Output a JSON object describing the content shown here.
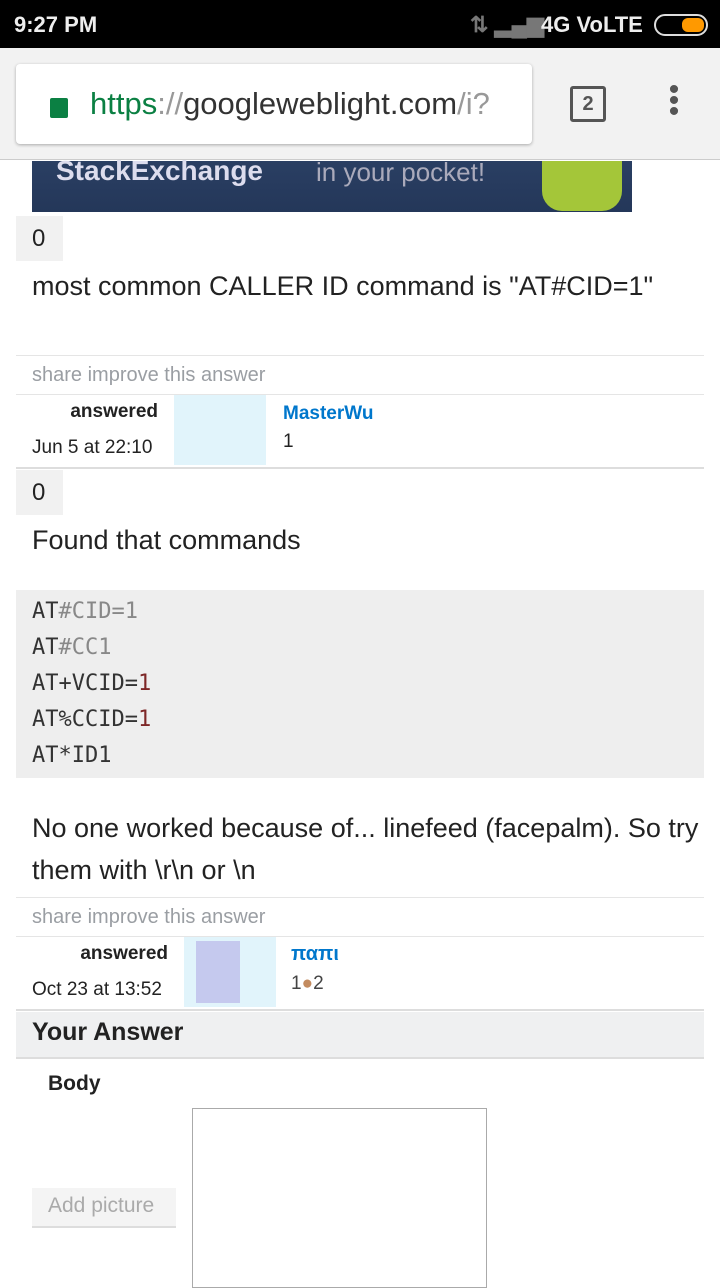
{
  "status": {
    "time": "9:27 PM",
    "network": "4G VoLTE"
  },
  "browser": {
    "url_scheme": "https",
    "url_sep": "://",
    "url_host": "googleweblight.com",
    "url_path": "/i?",
    "tab_count": "2"
  },
  "banner": {
    "text1": "StackExchange",
    "text2": "in your pocket!"
  },
  "answers": [
    {
      "votes": "0",
      "body": "most common CALLER ID command is \"AT#CID=1\"",
      "actions": "share improve this answer",
      "answered_label": "answered",
      "date": "Jun 5 at 22:10",
      "user": "MasterWu",
      "rep": "1"
    },
    {
      "votes": "0",
      "body1": "Found that commands",
      "code": [
        [
          "AT",
          "#CID=1",
          ""
        ],
        [
          "AT",
          "#CC1",
          ""
        ],
        [
          "AT+VCID=",
          "",
          "1"
        ],
        [
          "AT%CCID=",
          "",
          "1"
        ],
        [
          "AT*ID1",
          "",
          ""
        ]
      ],
      "body2": "No one worked because of... linefeed (facepalm). So try them with \\r\\n or \\n",
      "actions": "share improve this answer",
      "answered_label": "answered",
      "date": "Oct 23 at 13:52",
      "user": "παπι",
      "rep": "1",
      "badge_count": "2"
    }
  ],
  "your_answer": {
    "title": "Your Answer",
    "body_label": "Body",
    "add_picture": "Add picture"
  }
}
